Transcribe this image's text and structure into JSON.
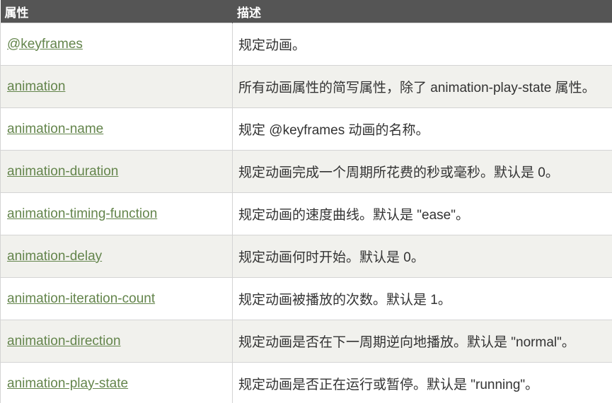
{
  "table": {
    "headers": [
      "属性",
      "描述"
    ],
    "rows": [
      {
        "property": "@keyframes",
        "description": "规定动画。"
      },
      {
        "property": "animation",
        "description": "所有动画属性的简写属性，除了 animation-play-state 属性。"
      },
      {
        "property": "animation-name",
        "description": "规定 @keyframes 动画的名称。"
      },
      {
        "property": "animation-duration",
        "description": "规定动画完成一个周期所花费的秒或毫秒。默认是 0。"
      },
      {
        "property": "animation-timing-function",
        "description": "规定动画的速度曲线。默认是 \"ease\"。"
      },
      {
        "property": "animation-delay",
        "description": "规定动画何时开始。默认是 0。"
      },
      {
        "property": "animation-iteration-count",
        "description": "规定动画被播放的次数。默认是 1。"
      },
      {
        "property": "animation-direction",
        "description": "规定动画是否在下一周期逆向地播放。默认是 \"normal\"。"
      },
      {
        "property": "animation-play-state",
        "description": "规定动画是否正在运行或暂停。默认是 \"running\"。"
      }
    ]
  },
  "colors": {
    "header_bg": "#555555",
    "header_text": "#ffffff",
    "link": "#64854c",
    "row_alt_bg": "#f1f1ed",
    "border": "#d4d4d4"
  }
}
